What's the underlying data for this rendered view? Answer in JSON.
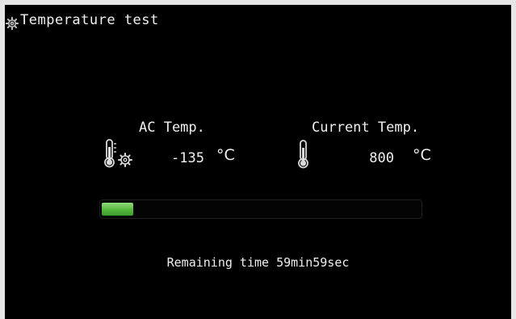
{
  "window": {
    "title": "Temperature test",
    "icon": "gear-icon"
  },
  "ac_temp": {
    "label": "AC Temp.",
    "value": "-135",
    "unit": "°C",
    "icon": "thermometer-gear-icon"
  },
  "current_temp": {
    "label": "Current Temp.",
    "value": "800",
    "unit": "°C",
    "icon": "thermometer-icon"
  },
  "progress": {
    "fraction": 0.1,
    "color": "#55b83e"
  },
  "status": {
    "remaining_text": "Remaining time 59min59sec"
  }
}
